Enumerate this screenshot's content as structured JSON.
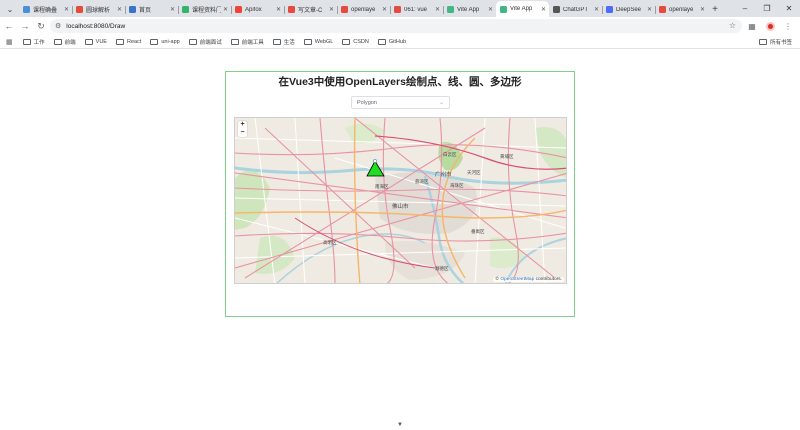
{
  "browser": {
    "tabs": [
      {
        "title": "课程确叠",
        "color": "#4a90d9",
        "active": false
      },
      {
        "title": "圆球解析",
        "color": "#e04e39",
        "active": false
      },
      {
        "title": "首页",
        "color": "#3b73c6",
        "active": false
      },
      {
        "title": "课程资料门",
        "color": "#34b36b",
        "active": false
      },
      {
        "title": "Apifox",
        "color": "#f04438",
        "active": false
      },
      {
        "title": "写文章-C",
        "color": "#e34b3f",
        "active": false
      },
      {
        "title": "openlaye",
        "color": "#e34b3f",
        "active": false
      },
      {
        "title": "061: vue",
        "color": "#e34b3f",
        "active": false
      },
      {
        "title": "Vite App",
        "color": "#41b883",
        "active": false
      },
      {
        "title": "Vite App",
        "color": "#41b883",
        "active": true
      },
      {
        "title": "ChatGPT",
        "color": "#555555",
        "active": false
      },
      {
        "title": "DeepSee",
        "color": "#4d6bfe",
        "active": false
      },
      {
        "title": "openlaye",
        "color": "#e34b3f",
        "active": false
      }
    ],
    "new_tab": "+",
    "url": "localhost:8080/Draw",
    "bookmarks": [
      "工作",
      "前端",
      "VUE",
      "React",
      "uni-app",
      "前端面试",
      "前端工具",
      "生活",
      "WebGL",
      "CSDN",
      "GitHub"
    ],
    "all_bookmarks": "所有书签"
  },
  "page": {
    "title": "在Vue3中使用OpenLayers绘制点、线、圆、多边形",
    "select_value": "Polygon",
    "zoom_in": "+",
    "zoom_out": "−",
    "attribution_prefix": "©",
    "attribution_link": "OpenStreetMap",
    "attribution_suffix": "contributors."
  },
  "map": {
    "labels": [
      {
        "text": "广州市"
      },
      {
        "text": "佛山市"
      },
      {
        "text": "海珠区"
      },
      {
        "text": "番禺区"
      },
      {
        "text": "白云区"
      },
      {
        "text": "黄埔区"
      },
      {
        "text": "天河区"
      },
      {
        "text": "南海区"
      },
      {
        "text": "顺德区"
      },
      {
        "text": "荔湾区"
      },
      {
        "text": "高明区"
      }
    ],
    "polygon_fill": "#22dd22",
    "polygon_stroke": "#000000"
  }
}
